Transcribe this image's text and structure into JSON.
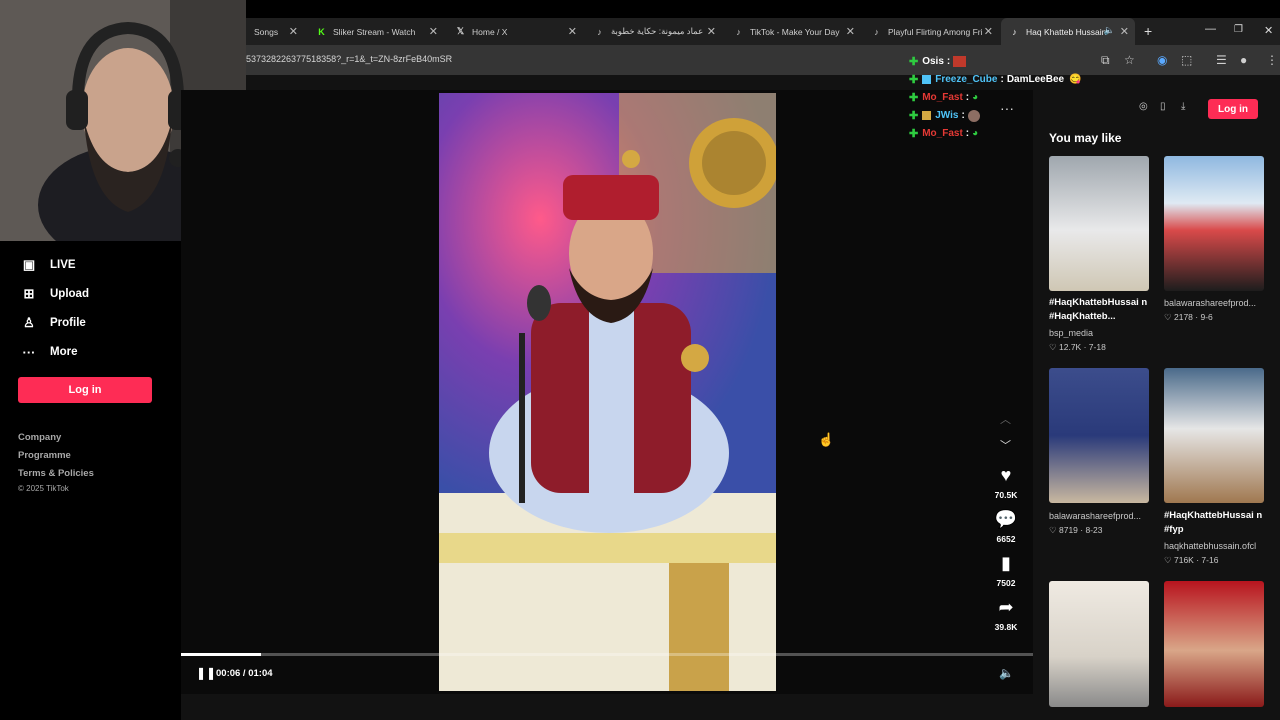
{
  "browser": {
    "tabs": [
      {
        "label": "Songs",
        "left": 0
      },
      {
        "label": "Sliker Stream - Watch"
      },
      {
        "label": "Home / X"
      },
      {
        "label": "عماد ميمونة: حكاية خطوبة"
      },
      {
        "label": "TikTok - Make Your Day"
      },
      {
        "label": "Playful Flirting Among Fri"
      },
      {
        "label": "Haq Khatteb Hussain"
      }
    ],
    "new_tab": "+",
    "url": "537328226377518358?_r=1&_t=ZN-8zrFeB40mSR"
  },
  "sidebar": {
    "items": [
      {
        "label": "LIVE",
        "icon": "live-icon"
      },
      {
        "label": "Upload",
        "icon": "upload-icon"
      },
      {
        "label": "Profile",
        "icon": "profile-icon"
      },
      {
        "label": "More",
        "icon": "more-icon"
      }
    ],
    "login": "Log in",
    "footer": [
      "Company",
      "Programme",
      "Terms & Policies",
      "© 2025 TikTok"
    ]
  },
  "video": {
    "likes": "70.5K",
    "comments": "6652",
    "saves": "7502",
    "shares": "39.8K",
    "time": "00:06 / 01:04",
    "progress": 0.094
  },
  "chat": [
    {
      "user": "Osis",
      "color": "#ffffff",
      "msg": ""
    },
    {
      "user": "Freeze_Cube",
      "color": "#4fc3f7",
      "msg": "DamLeeBee"
    },
    {
      "user": "Mo_Fast",
      "color": "#e53935",
      "msg": ""
    },
    {
      "user": "JWis",
      "color": "#4fc3f7",
      "msg": ""
    },
    {
      "user": "Mo_Fast",
      "color": "#e53935",
      "msg": ""
    }
  ],
  "right": {
    "login": "Log in",
    "heading": "You may like",
    "cards": [
      {
        "title": "#HaqKhattebHussai n #HaqKhatteb...",
        "author": "bsp_media",
        "likes": "12.7K",
        "date": "7-18"
      },
      {
        "title": "",
        "author": "balawarashareefprod...",
        "likes": "2178",
        "date": "9-6"
      },
      {
        "title": "",
        "author": "balawarashareefprod...",
        "likes": "8719",
        "date": "8-23"
      },
      {
        "title": "#HaqKhattebHussai n #fyp",
        "author": "haqkhattebhussain.ofcl",
        "likes": "716K",
        "date": "7-16"
      }
    ]
  },
  "colors": {
    "accent": "#fe2c55",
    "bg": "#121212"
  }
}
